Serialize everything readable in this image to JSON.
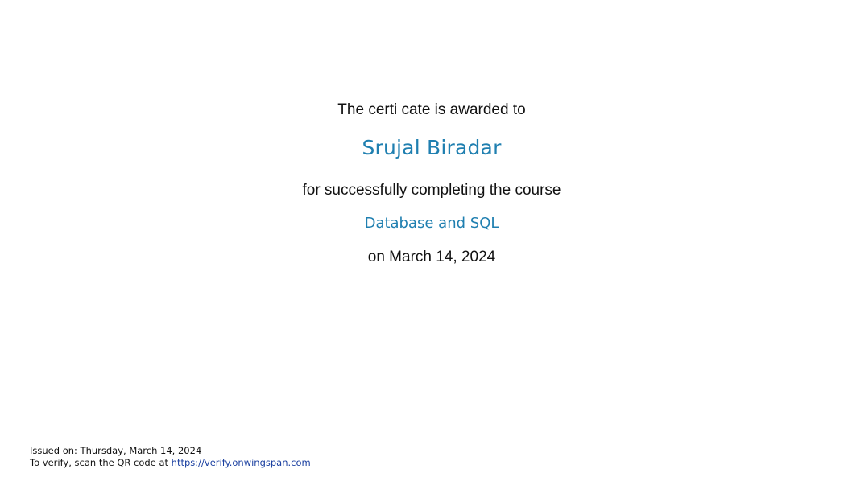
{
  "certificate": {
    "awarded_text": "The certi cate is awarded to",
    "recipient_name": "Srujal Biradar",
    "completion_text": "for successfully completing the course",
    "course_name": "Database and SQL",
    "completion_date": "on March 14, 2024"
  },
  "footer": {
    "issued_on": "Issued on: Thursday, March 14, 2024",
    "verify_prefix": "To verify, scan the QR code at ",
    "verify_link": "https://verify.onwingspan.com"
  },
  "colors": {
    "accent": "#1f7fb0",
    "link": "#1a3fa0",
    "text": "#111111",
    "background": "#ffffff"
  }
}
